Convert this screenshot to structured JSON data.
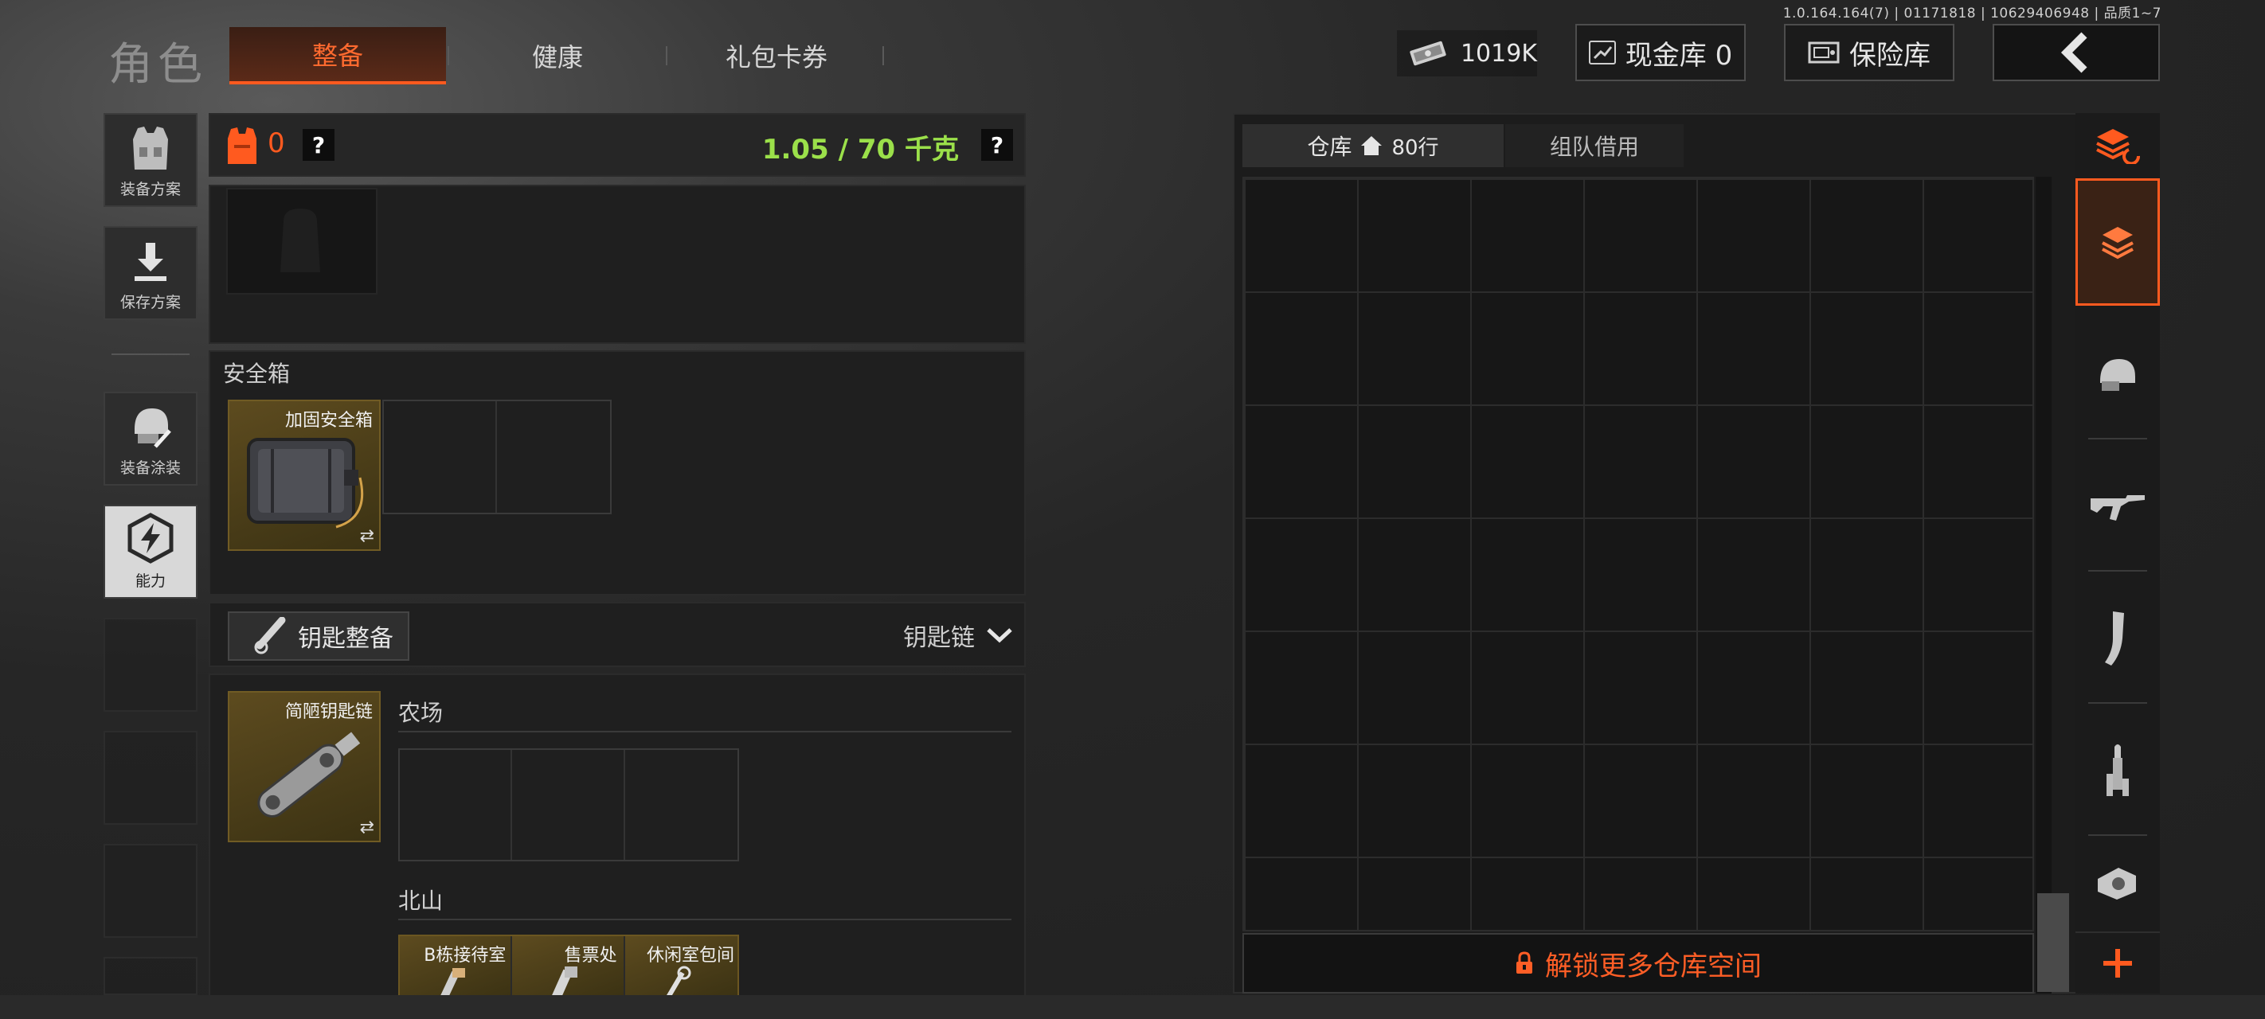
{
  "version": "1.0.164.164(7) | 01171818 | 10629406948 | 品质1~7",
  "header": {
    "title": "角色",
    "tabs": [
      {
        "label": "整备",
        "active": true
      },
      {
        "label": "健康"
      },
      {
        "label": "礼包卡券"
      }
    ],
    "money": "1019K",
    "cash_vault": "现金库 0",
    "safe_vault": "保险库"
  },
  "sidebar": {
    "items": [
      {
        "label": "装备方案"
      },
      {
        "label": "保存方案"
      },
      {
        "label": "装备涂装"
      },
      {
        "label": "能力",
        "active": true
      }
    ]
  },
  "loadout": {
    "armor_count": "0",
    "weight": "1.05 / 70 千克",
    "help": "?"
  },
  "safebox": {
    "title": "安全箱",
    "item_name": "加固安全箱"
  },
  "keys": {
    "button_label": "钥匙整备",
    "dropdown_label": "钥匙链",
    "keychain_name": "简陋钥匙链",
    "sections": [
      {
        "title": "农场"
      },
      {
        "title": "北山",
        "slots": [
          "B栋接待室",
          "售票处",
          "休闲室包间"
        ]
      }
    ]
  },
  "warehouse": {
    "tabs": [
      {
        "label": "仓库",
        "rows": "80行",
        "active": true
      },
      {
        "label": "组队借用"
      }
    ],
    "unlock_label": "解锁更多仓库空间"
  },
  "colors": {
    "accent": "#ff5a1f",
    "weight_green": "#9be04a"
  }
}
